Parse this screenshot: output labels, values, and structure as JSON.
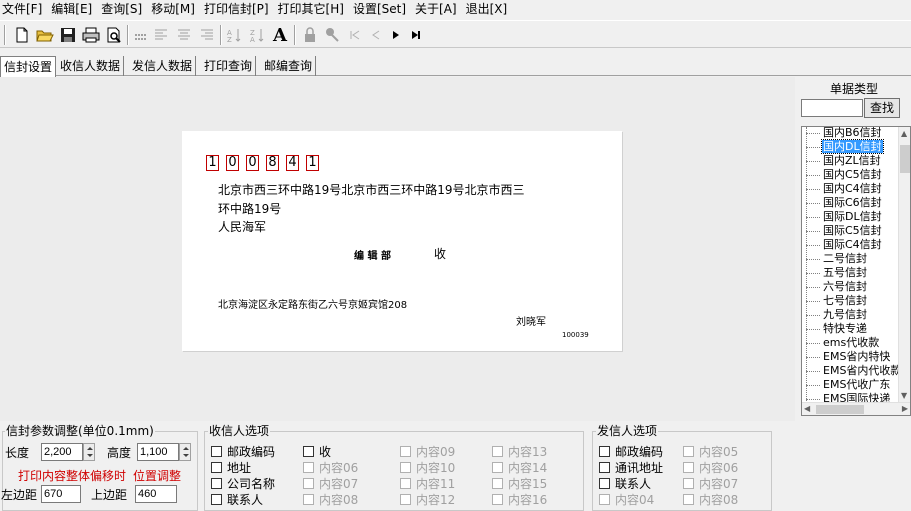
{
  "menu": [
    "文件[F]",
    "编辑[E]",
    "查询[S]",
    "移动[M]",
    "打印信封[P]",
    "打印其它[H]",
    "设置[Set]",
    "关于[A]",
    "退出[X]"
  ],
  "toolbar": {
    "icons": [
      "new-file-icon",
      "open-folder-icon",
      "save-icon",
      "print-icon",
      "print-preview-icon",
      "grid-icon",
      "align-left-icon",
      "align-center-icon",
      "align-right-icon",
      "sort-ascending-icon",
      "sort-descending-icon",
      "font-icon",
      "lock-icon",
      "pin-icon",
      "first-record-icon",
      "prev-record-icon",
      "next-record-icon",
      "last-record-icon"
    ],
    "font_glyph": "A"
  },
  "tabs": [
    "信封设置",
    "收信人数据",
    "发信人数据",
    "打印查询",
    "邮编查询"
  ],
  "envelope": {
    "zip": [
      "1",
      "0",
      "0",
      "8",
      "4",
      "1"
    ],
    "address_line1": "北京市西三环中路19号北京市西三环中路19号北京市西三",
    "address_line2": "环中路19号",
    "company": "人民海军",
    "recipient_name": "编 辑 部",
    "recipient_suffix": "收",
    "sender_address": "北京海淀区永定路东街乙六号京姬宾馆208",
    "sender_name": "刘晓军",
    "sender_zip": "100039"
  },
  "side": {
    "title": "单据类型",
    "search_value": "",
    "search_button": "查找",
    "items": [
      "国内B6信封",
      "国内DL信封",
      "国内ZL信封",
      "国内C5信封",
      "国内C4信封",
      "国际C6信封",
      "国际DL信封",
      "国际C5信封",
      "国际C4信封",
      "二号信封",
      "五号信封",
      "六号信封",
      "七号信封",
      "九号信封",
      "特快专递",
      "ems代收款",
      "EMS省内特快",
      "EMS省内代收款",
      "EMS代收广东",
      "EMS国际快递"
    ],
    "selected_index": 1
  },
  "params": {
    "title": "信封参数调整(单位0.1mm)",
    "length_label": "长度",
    "length_value": "2,200",
    "height_label": "高度",
    "height_value": "1,100",
    "offset_label": "打印内容整体偏移时",
    "position_label": "位置调整",
    "left_label": "左边距",
    "left_value": "670",
    "top_label": "上边距",
    "top_value": "460"
  },
  "recipient_options": {
    "title": "收信人选项",
    "col1": [
      "邮政编码",
      "地址",
      "公司名称",
      "联系人"
    ],
    "col2": [
      "收",
      "内容06",
      "内容07",
      "内容08"
    ],
    "col3": [
      "内容09",
      "内容10",
      "内容11",
      "内容12"
    ],
    "col4": [
      "内容13",
      "内容14",
      "内容15",
      "内容16"
    ]
  },
  "sender_options": {
    "title": "发信人选项",
    "col1": [
      "邮政编码",
      "通讯地址",
      "联系人",
      "内容04"
    ],
    "col2": [
      "内容05",
      "内容06",
      "内容07",
      "内容08"
    ]
  }
}
